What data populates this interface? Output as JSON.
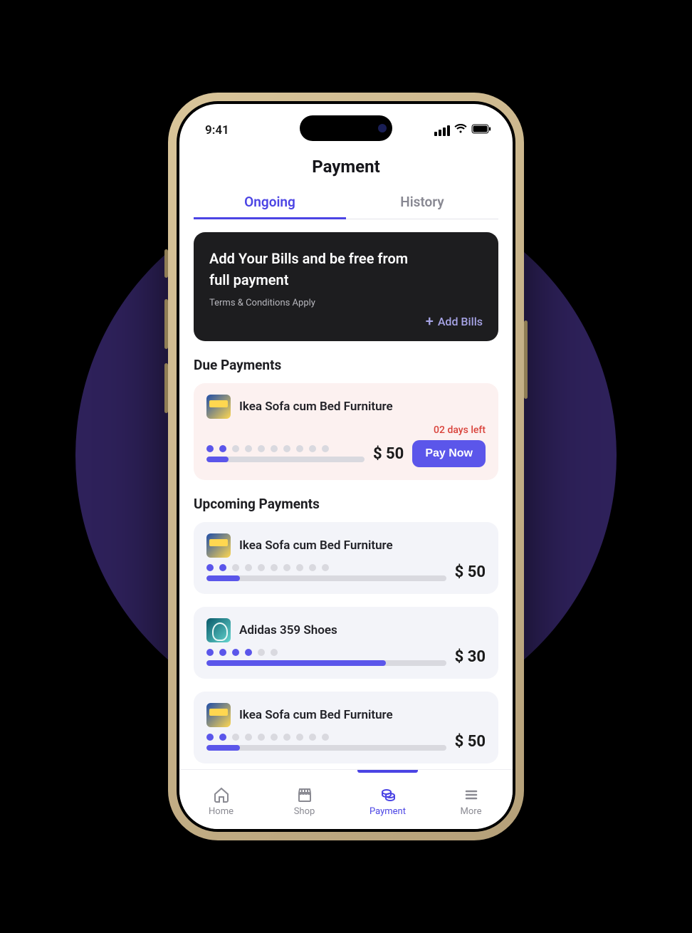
{
  "status": {
    "time": "9:41"
  },
  "page": {
    "title": "Payment"
  },
  "tabs": [
    {
      "label": "Ongoing",
      "active": true
    },
    {
      "label": "History",
      "active": false
    }
  ],
  "promo": {
    "title_line1": "Add Your Bills  and be free from",
    "title_line2": "full payment",
    "subtitle": "Terms & Conditions Apply",
    "action_label": "Add Bills"
  },
  "due_section": {
    "heading": "Due Payments"
  },
  "due_payments": [
    {
      "title": "Ikea Sofa cum Bed Furniture",
      "thumb": "ikea",
      "days_left": "02 days left",
      "amount": "$ 50",
      "dots_total": 10,
      "dots_filled": 2,
      "progress_pct": 14,
      "button": "Pay Now"
    }
  ],
  "upcoming_section": {
    "heading": "Upcoming Payments"
  },
  "upcoming_payments": [
    {
      "title": "Ikea Sofa cum Bed Furniture",
      "thumb": "ikea",
      "amount": "$ 50",
      "dots_total": 10,
      "dots_filled": 2,
      "progress_pct": 14
    },
    {
      "title": "Adidas 359 Shoes",
      "thumb": "adidas",
      "amount": "$ 30",
      "dots_total": 6,
      "dots_filled": 4,
      "progress_pct": 75
    },
    {
      "title": "Ikea Sofa cum Bed Furniture",
      "thumb": "ikea",
      "amount": "$ 50",
      "dots_total": 10,
      "dots_filled": 2,
      "progress_pct": 14
    }
  ],
  "nav": [
    {
      "label": "Home",
      "icon": "home",
      "active": false
    },
    {
      "label": "Shop",
      "icon": "shop",
      "active": false
    },
    {
      "label": "Payment",
      "icon": "payment",
      "active": true
    },
    {
      "label": "More",
      "icon": "more",
      "active": false
    }
  ]
}
